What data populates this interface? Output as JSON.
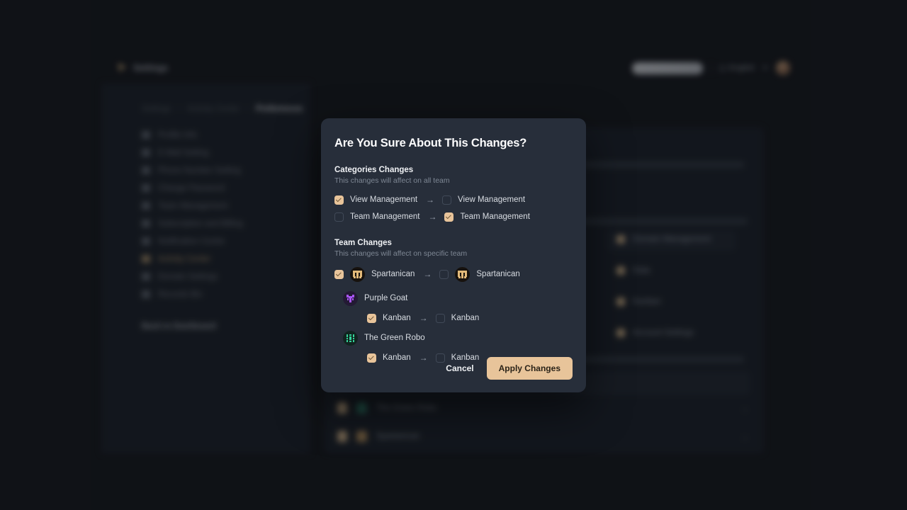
{
  "background": {
    "brand": {
      "label": "Settings",
      "icon": "feather-icon"
    },
    "header": {
      "search_placeholder": "",
      "language": "English",
      "caret_icon": "chevron-down-icon",
      "globe_icon": "globe-icon",
      "avatar_icon": "user-avatar"
    },
    "breadcrumb": [
      {
        "label": "Settings",
        "active": false
      },
      {
        "label": "Activity Center",
        "active": false
      },
      {
        "label": "Preferences",
        "active": true
      }
    ],
    "breadcrumb_separator": "/",
    "nav_items": [
      {
        "label": "Profile Info",
        "icon": "user-icon",
        "selected": false
      },
      {
        "label": "E-Mail Setting",
        "icon": "mail-icon",
        "selected": false
      },
      {
        "label": "Phone Number Setting",
        "icon": "phone-icon",
        "selected": false
      },
      {
        "label": "Change Password",
        "icon": "lock-icon",
        "selected": false
      },
      {
        "label": "Team Management",
        "icon": "users-icon",
        "selected": false
      },
      {
        "label": "Subscription and Billing",
        "icon": "card-icon",
        "selected": false
      },
      {
        "label": "Notification Center",
        "icon": "bell-icon",
        "selected": false
      },
      {
        "label": "Activity Center",
        "icon": "activity-icon",
        "selected": true
      },
      {
        "label": "Domain Settings",
        "icon": "globe-icon",
        "selected": false
      },
      {
        "label": "Records Bin",
        "icon": "trash-icon",
        "selected": false
      }
    ],
    "back_link": "Back to Dashboard",
    "main_options": [
      {
        "label": "Domain Management"
      },
      {
        "label": "Data"
      },
      {
        "label": "Kanban"
      },
      {
        "label": "Account Settings"
      }
    ],
    "team_rows": [
      {
        "label": "The Green Robo",
        "chevron": "chevron-down-icon"
      },
      {
        "label": "Spartanican",
        "chevron": "chevron-down-icon"
      }
    ]
  },
  "modal": {
    "title": "Are You Sure About This Changes?",
    "sections": {
      "categories": {
        "title": "Categories Changes",
        "subtitle": "This changes will affect on all team",
        "rows": [
          {
            "from_label": "View Management",
            "from_checked": true,
            "to_label": "View Management",
            "to_checked": false
          },
          {
            "from_label": "Team Management",
            "from_checked": false,
            "to_label": "Team Management",
            "to_checked": true
          }
        ]
      },
      "team": {
        "title": "Team Changes",
        "subtitle": "This changes will affect on specific team",
        "main_row": {
          "from_checked": true,
          "from_label": "Spartanican",
          "to_checked": false,
          "to_label": "Spartanican",
          "avatar": "spartan-mask-icon"
        },
        "teams": [
          {
            "name": "Purple Goat",
            "avatar": "purple-goat-icon",
            "rows": [
              {
                "from_label": "Kanban",
                "from_checked": true,
                "to_label": "Kanban",
                "to_checked": false
              }
            ]
          },
          {
            "name": "The Green Robo",
            "avatar": "green-robo-icon",
            "rows": [
              {
                "from_label": "Kanban",
                "from_checked": true,
                "to_label": "Kanban",
                "to_checked": false
              }
            ]
          }
        ]
      }
    },
    "arrow_glyph": "→",
    "cancel_label": "Cancel",
    "apply_label": "Apply Changes"
  },
  "colors": {
    "accent": "#e8c49a",
    "modal_bg": "#272e3a",
    "page_bg": "#16191e",
    "panel_bg": "#1d232c",
    "purple": "#a855f7",
    "green": "#34d399"
  }
}
